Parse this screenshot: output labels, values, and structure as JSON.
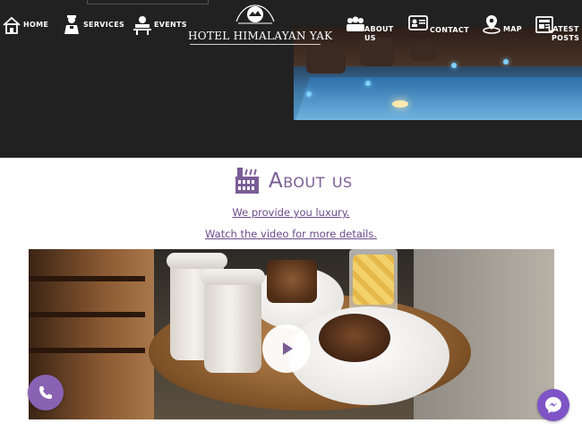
{
  "header": {
    "brand": "HOTEL HIMALAYAN YAK",
    "nav": [
      {
        "label": "HOME",
        "icon": "home-icon"
      },
      {
        "label": "SERVICES",
        "icon": "concierge-icon"
      },
      {
        "label": "EVENTS",
        "icon": "events-icon"
      },
      {
        "label": "ABOUT",
        "label2": "US",
        "icon": "people-icon"
      },
      {
        "label": "CONTACT",
        "icon": "contact-card-icon"
      },
      {
        "label": "MAP",
        "icon": "map-pin-icon"
      },
      {
        "label": "LATEST",
        "label2": "POSTS",
        "icon": "news-icon"
      }
    ]
  },
  "about": {
    "title": "About us",
    "link1": "We provide you luxury.",
    "link2": "Watch the video for more details."
  },
  "colors": {
    "header_bg": "#222121",
    "accent_purple": "#7a5d95",
    "button_purple": "#8a62b4"
  },
  "icons": {
    "title": "hotel-building-icon",
    "play": "play-icon",
    "phone": "phone-icon",
    "messenger": "messenger-icon"
  }
}
